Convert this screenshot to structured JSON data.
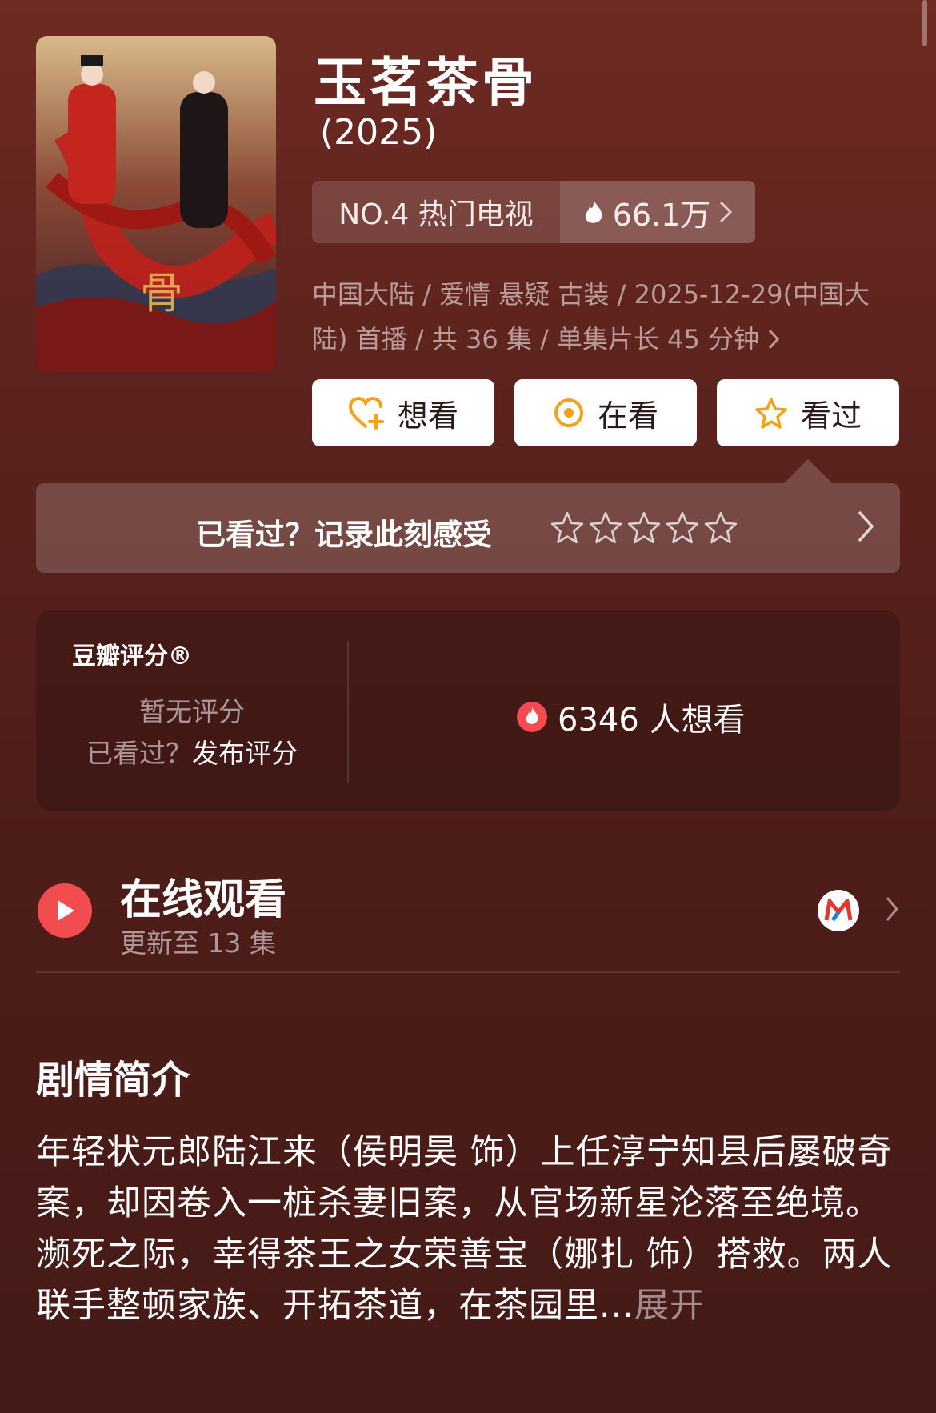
{
  "show": {
    "title": "玉茗茶骨",
    "year": "(2025)"
  },
  "ranking": {
    "label": "NO.4 热门电视",
    "heat": "66.1万"
  },
  "meta": {
    "line1": "中国大陆 / 爱情 悬疑 古装 / 2025-12-29(中国大",
    "line2": "陆) 首播 / 共 36 集 / 单集片长 45 分钟"
  },
  "actions": {
    "want": "想看",
    "watching": "在看",
    "watched": "看过"
  },
  "record": {
    "prompt": "已看过？记录此刻感受",
    "star_count": 5
  },
  "rating": {
    "brand": "豆瓣评分®",
    "none": "暂无评分",
    "watched_q": "已看过？",
    "post": "发布评分",
    "want_count": "6346 人想看"
  },
  "watch": {
    "title": "在线观看",
    "subtitle": "更新至 13 集"
  },
  "synopsis": {
    "title": "剧情简介",
    "text": "年轻状元郎陆江来（侯明昊 饰）上任淳宁知县后屡破奇案，却因卷入一桩杀妻旧案，从官场新星沦落至绝境。濒死之际，幸得茶王之女荣善宝（娜扎 饰）搭救。两人联手整顿家族、开拓茶道，在茶园里...",
    "more": "展开"
  },
  "colors": {
    "background": "#5b221d",
    "accent_red": "#f24b50",
    "icon_orange": "#f5a21b"
  }
}
